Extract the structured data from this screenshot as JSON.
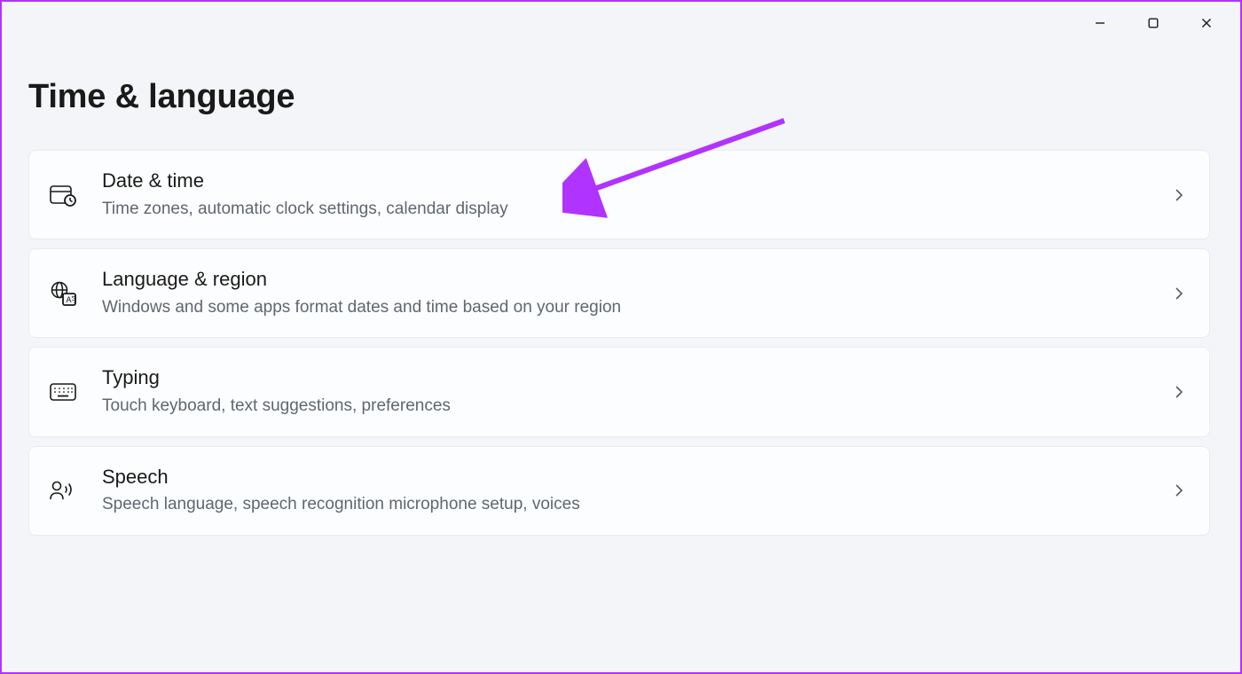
{
  "page": {
    "title": "Time & language"
  },
  "items": [
    {
      "title": "Date & time",
      "desc": "Time zones, automatic clock settings, calendar display"
    },
    {
      "title": "Language & region",
      "desc": "Windows and some apps format dates and time based on your region"
    },
    {
      "title": "Typing",
      "desc": "Touch keyboard, text suggestions, preferences"
    },
    {
      "title": "Speech",
      "desc": "Speech language, speech recognition microphone setup, voices"
    }
  ],
  "annotation": {
    "arrow_color": "#b033ff"
  }
}
